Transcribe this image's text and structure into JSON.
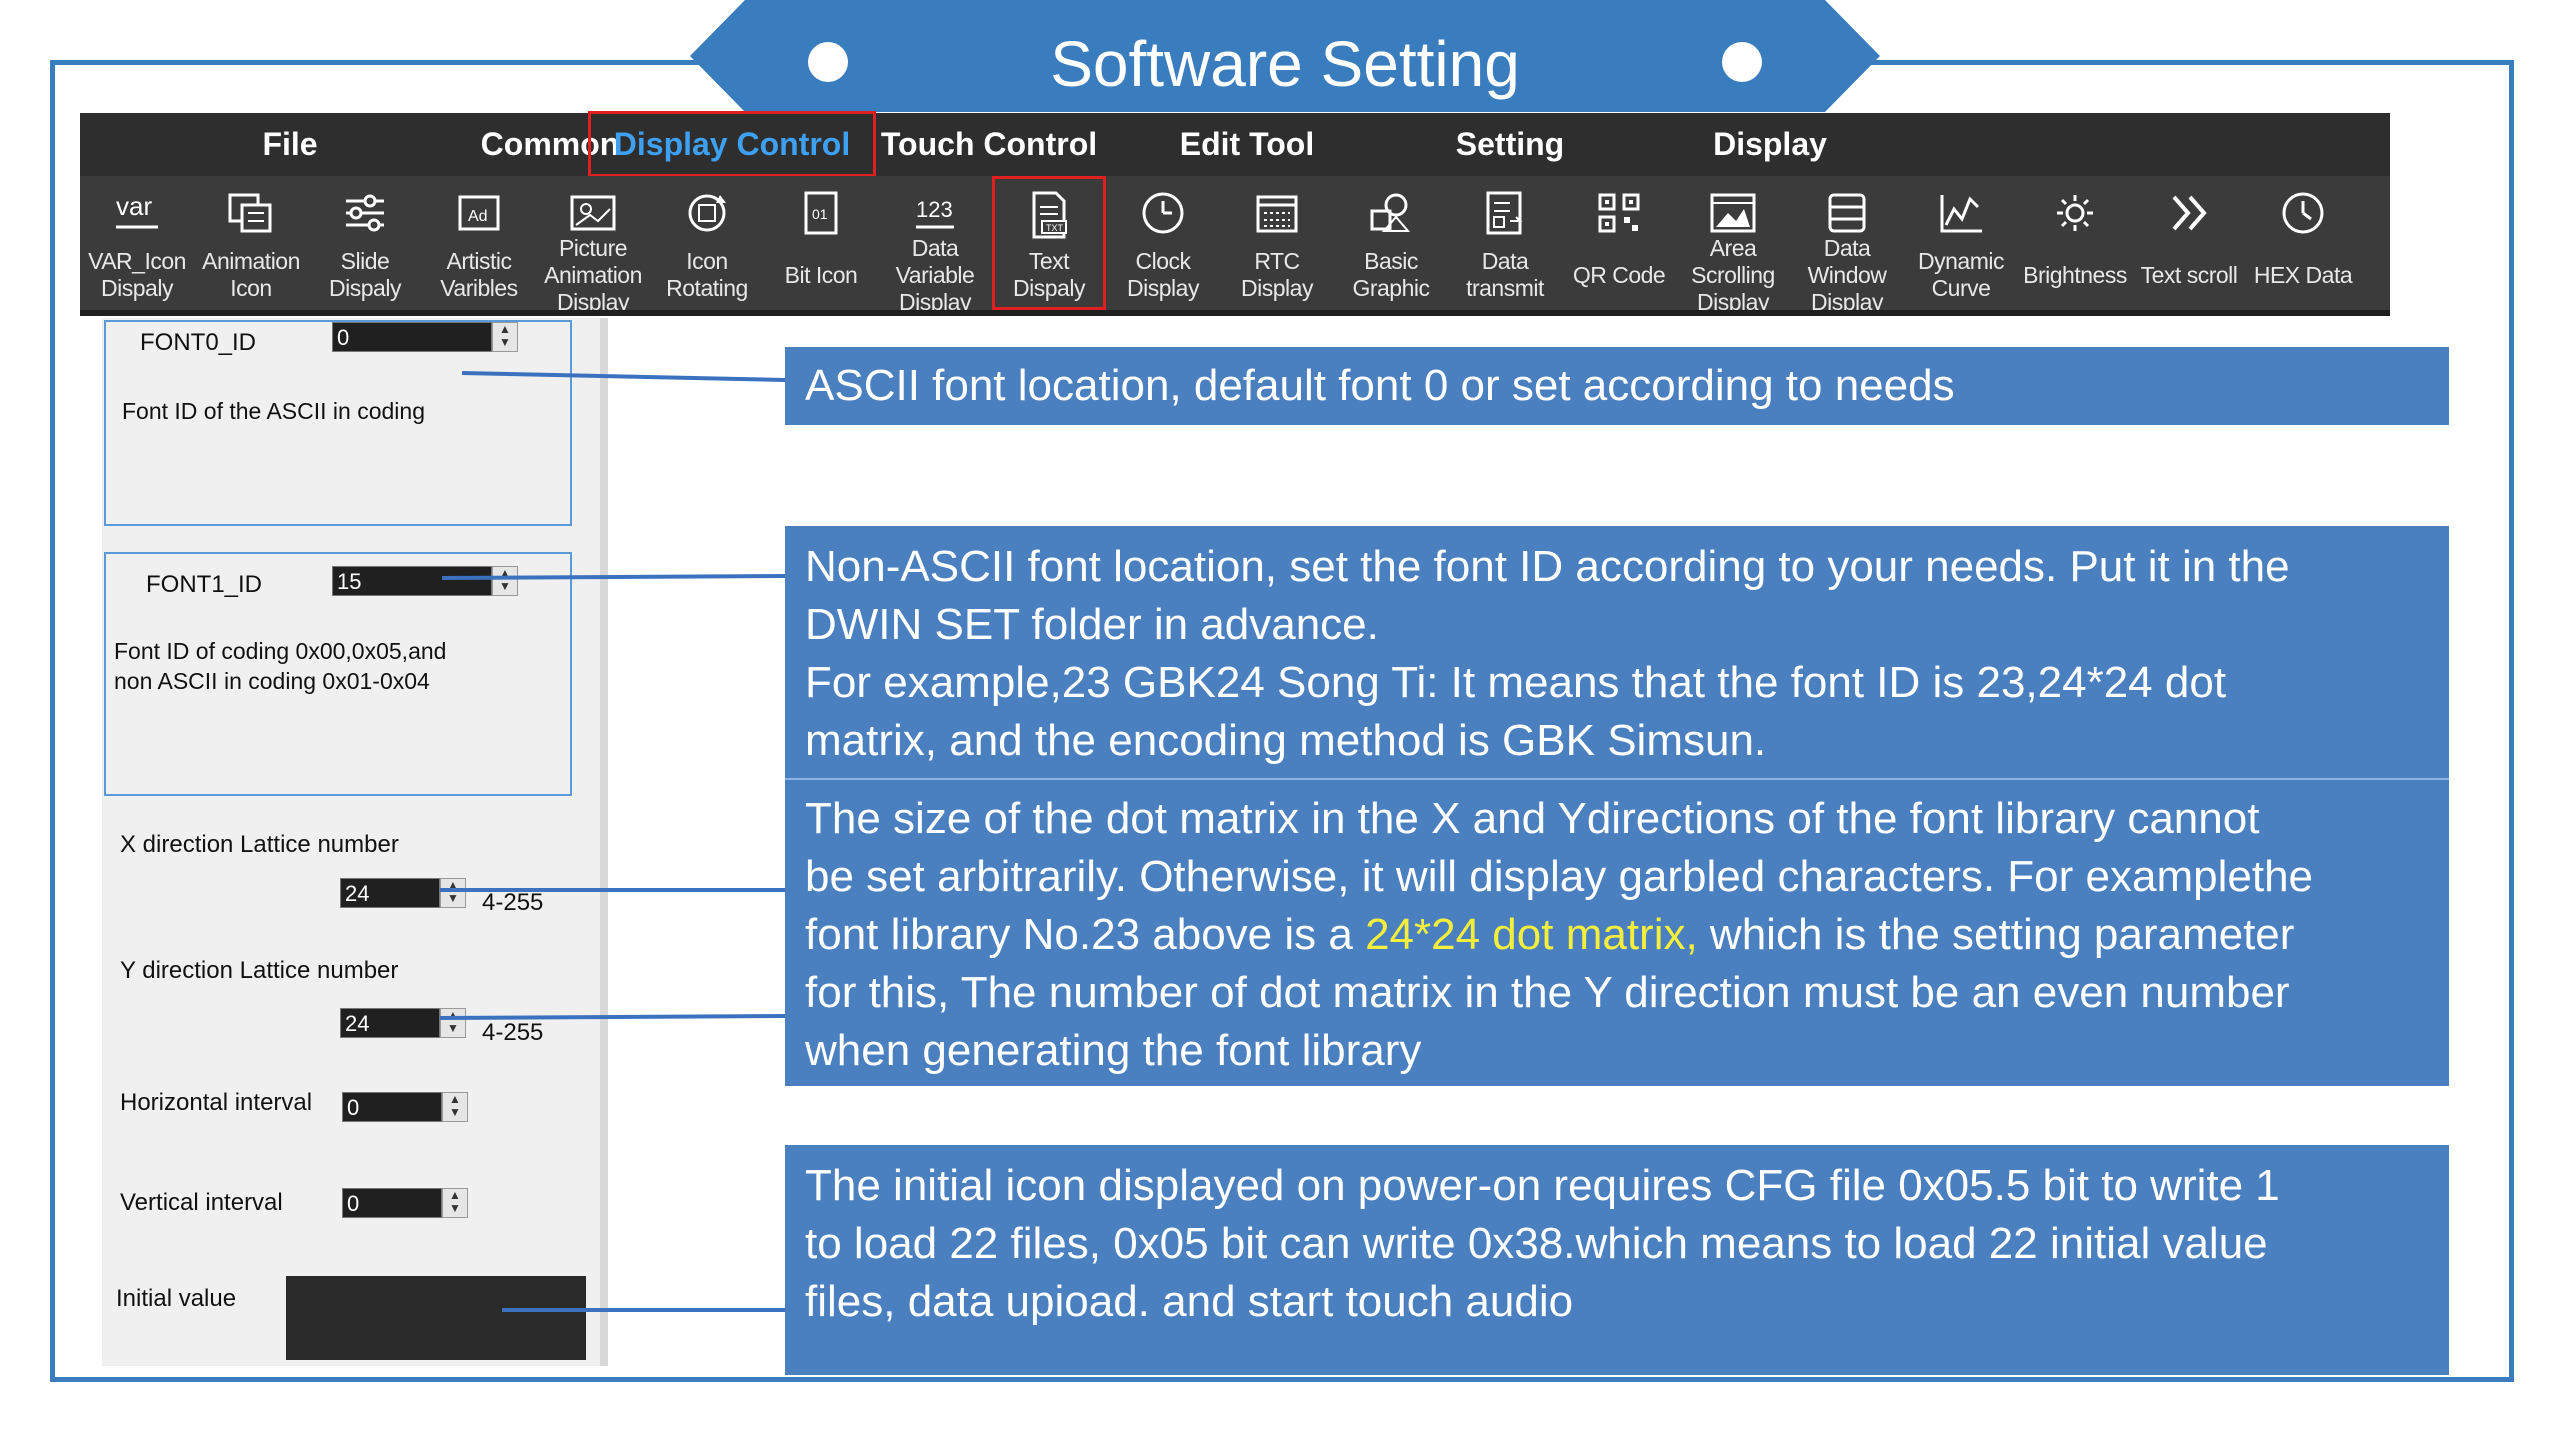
{
  "banner": {
    "title": "Software Setting",
    "color": "#3a7dbf"
  },
  "menu": [
    {
      "label": "File"
    },
    {
      "label": "Common"
    },
    {
      "label": "Display Control",
      "active": true
    },
    {
      "label": "Touch Control"
    },
    {
      "label": "Edit Tool"
    },
    {
      "label": "Setting"
    },
    {
      "label": "Display"
    }
  ],
  "tools": [
    {
      "label": "VAR_Icon\nDispaly",
      "icon": "var-icon"
    },
    {
      "label": "Animation\nIcon",
      "icon": "animation-icon"
    },
    {
      "label": "Slide\nDispaly",
      "icon": "slider-icon"
    },
    {
      "label": "Artistic\nVaribles",
      "icon": "artistic-icon"
    },
    {
      "label": "Picture\nAnimation\nDisplay",
      "icon": "picture-icon"
    },
    {
      "label": "Icon\nRotating",
      "icon": "rotate-icon"
    },
    {
      "label": "Bit Icon",
      "icon": "bit-icon"
    },
    {
      "label": "Data\nVariable\nDisplay",
      "icon": "number-icon"
    },
    {
      "label": "Text\nDispaly",
      "icon": "text-icon",
      "selected": true
    },
    {
      "label": "Clock\nDisplay",
      "icon": "clock-icon"
    },
    {
      "label": "RTC\nDisplay",
      "icon": "calendar-icon"
    },
    {
      "label": "Basic\nGraphic",
      "icon": "shapes-icon"
    },
    {
      "label": "Data\ntransmit",
      "icon": "transmit-icon"
    },
    {
      "label": "QR Code",
      "icon": "qr-icon"
    },
    {
      "label": "Area\nScrolling\nDisplay",
      "icon": "scroll-area-icon"
    },
    {
      "label": "Data\nWindow\nDisplay",
      "icon": "window-icon"
    },
    {
      "label": "Dynamic\nCurve",
      "icon": "curve-icon"
    },
    {
      "label": "Brightness",
      "icon": "brightness-icon"
    },
    {
      "label": "Text scroll",
      "icon": "double-chevron-icon"
    },
    {
      "label": "HEX Data",
      "icon": "hex-clock-icon"
    }
  ],
  "panel": {
    "font0_label": "FONT0_ID",
    "font0_value": "0",
    "font0_desc": "Font ID of the ASCII in coding",
    "font1_label": "FONT1_ID",
    "font1_value": "15",
    "font1_desc": "Font ID of coding 0x00,0x05,and\nnon ASCII in coding 0x01-0x04",
    "x_label": "X direction Lattice number",
    "x_value": "24",
    "x_range": "4-255",
    "y_label": "Y direction Lattice number",
    "y_value": "24",
    "y_range": "4-255",
    "h_label": "Horizontal interval",
    "h_value": "0",
    "v_label": "Vertical interval",
    "v_value": "0",
    "init_label": "Initial value"
  },
  "callouts": {
    "c1": "ASCII font location, default font 0 or set according to needs",
    "c2": "Non-ASCII font location, set the font ID according to your needs. Put it in the\nDWIN SET folder in advance.\nFor example,23 GBK24 Song Ti: It means that the font ID is 23,24*24 dot\nmatrix, and the encoding method is GBK Simsun.",
    "c3a": "The size of the dot matrix in the X and Ydirections of the font library cannot\nbe set arbitrarily. Otherwise, it will display garbled characters. For examplethe\nfont library No.23 above is a ",
    "c3_highlight": "24*24 dot matrix,",
    "c3b": " which is the setting parameter\nfor this, The number of dot matrix in the Y direction must be an even number\nwhen generating the font library",
    "c4": "The initial icon displayed on power-on requires CFG file 0x05.5 bit to write 1\nto load 22 files, 0x05 bit can write 0x38.which means to load 22 initial value\nfiles, data upioad. and start touch audio"
  },
  "colors": {
    "callout": "#4a7fc0",
    "highlight": "#f4ef3c",
    "frame": "#3a7dbf",
    "active_menu": "#3da0f0",
    "selection": "#e02020"
  }
}
